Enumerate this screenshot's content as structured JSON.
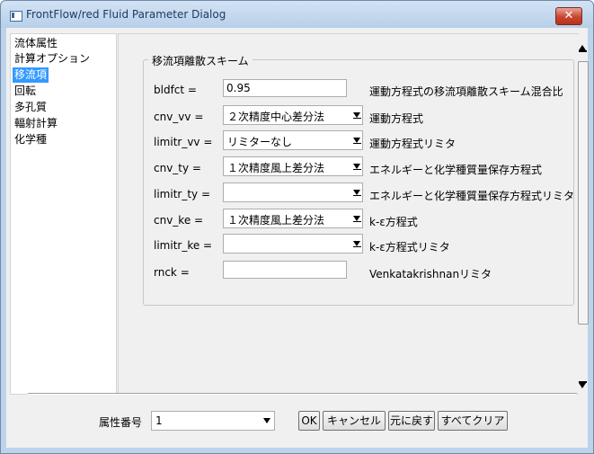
{
  "window": {
    "title": "FrontFlow/red Fluid Parameter Dialog",
    "close_glyph": "✕"
  },
  "nav": {
    "items": [
      {
        "label": "流体属性",
        "selected": false
      },
      {
        "label": "計算オプション",
        "selected": false
      },
      {
        "label": "移流項",
        "selected": true
      },
      {
        "label": "回転",
        "selected": false
      },
      {
        "label": "多孔質",
        "selected": false
      },
      {
        "label": "輻射計算",
        "selected": false
      },
      {
        "label": "化学種",
        "selected": false
      }
    ]
  },
  "group": {
    "title": "移流項離散スキーム"
  },
  "params": {
    "bldfct": {
      "label": "bldfct =",
      "value": "0.95",
      "desc": "運動方程式の移流項離散スキーム混合比"
    },
    "cnv_vv": {
      "label": "cnv_vv =",
      "value": "２次精度中心差分法",
      "desc": "運動方程式"
    },
    "limitr_vv": {
      "label": "limitr_vv =",
      "value": "リミターなし",
      "desc": "運動方程式リミタ"
    },
    "cnv_ty": {
      "label": "cnv_ty =",
      "value": "１次精度風上差分法",
      "desc": "エネルギーと化学種質量保存方程式"
    },
    "limitr_ty": {
      "label": "limitr_ty =",
      "value": "",
      "desc": "エネルギーと化学種質量保存方程式リミタ"
    },
    "cnv_ke": {
      "label": "cnv_ke =",
      "value": "１次精度風上差分法",
      "desc": "k-ε方程式"
    },
    "limitr_ke": {
      "label": "limitr_ke =",
      "value": "",
      "desc": "k-ε方程式リミタ"
    },
    "rnck": {
      "label": "rnck =",
      "value": "",
      "desc": "Venkatakrishnanリミタ"
    }
  },
  "footer": {
    "property_label": "属性番号",
    "property_value": "1",
    "ok_label": "OK",
    "cancel_label": "キャンセル",
    "revert_label": "元に戻す",
    "clear_all_label": "すべてクリア"
  },
  "colors": {
    "selection": "#3399ff",
    "title_bar": "#c5daf0",
    "close_button": "#c8462f"
  }
}
